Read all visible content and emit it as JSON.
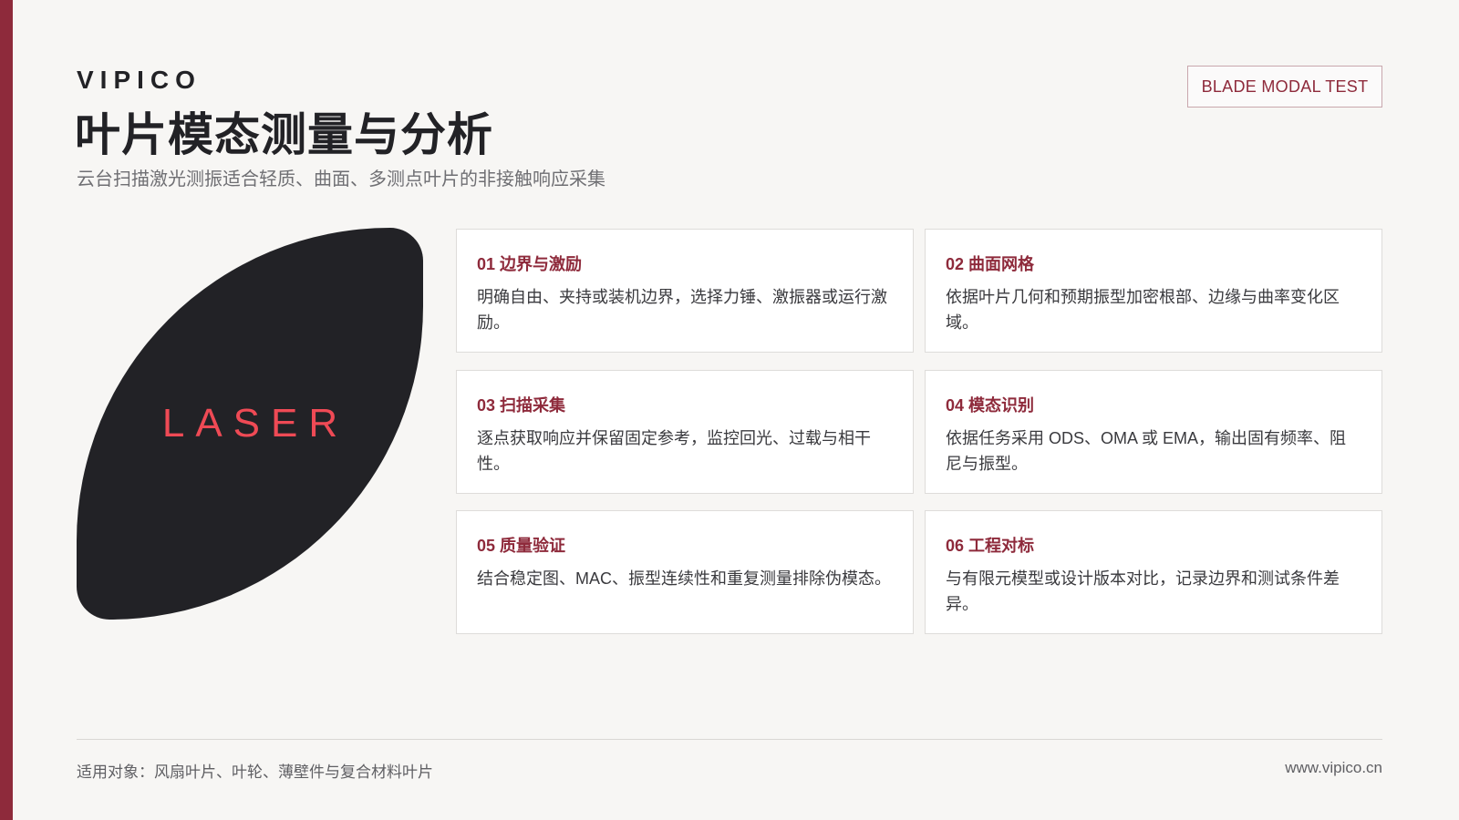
{
  "header": {
    "brand": "VIPICO",
    "title": "叶片模态测量与分析",
    "subtitle": "云台扫描激光测振适合轻质、曲面、多测点叶片的非接触响应采集",
    "tag": "BLADE MODAL TEST"
  },
  "visual": {
    "label": "LASER"
  },
  "cards": [
    {
      "title": "01 边界与激励",
      "text": "明确自由、夹持或装机边界，选择力锤、激振器或运行激励。"
    },
    {
      "title": "02 曲面网格",
      "text": "依据叶片几何和预期振型加密根部、边缘与曲率变化区域。"
    },
    {
      "title": "03 扫描采集",
      "text": "逐点获取响应并保留固定参考，监控回光、过载与相干性。"
    },
    {
      "title": "04 模态识别",
      "text": "依据任务采用 ODS、OMA 或 EMA，输出固有频率、阻尼与振型。"
    },
    {
      "title": "05 质量验证",
      "text": "结合稳定图、MAC、振型连续性和重复测量排除伪模态。"
    },
    {
      "title": "06 工程对标",
      "text": "与有限元模型或设计版本对比，记录边界和测试条件差异。"
    }
  ],
  "footer": {
    "scope": "适用对象：风扇叶片、叶轮、薄壁件与复合材料叶片",
    "website": "www.vipico.cn"
  },
  "colors": {
    "accent": "#8e2a3b",
    "dark": "#222226",
    "laser": "#ef4a55",
    "background": "#f7f6f4"
  }
}
